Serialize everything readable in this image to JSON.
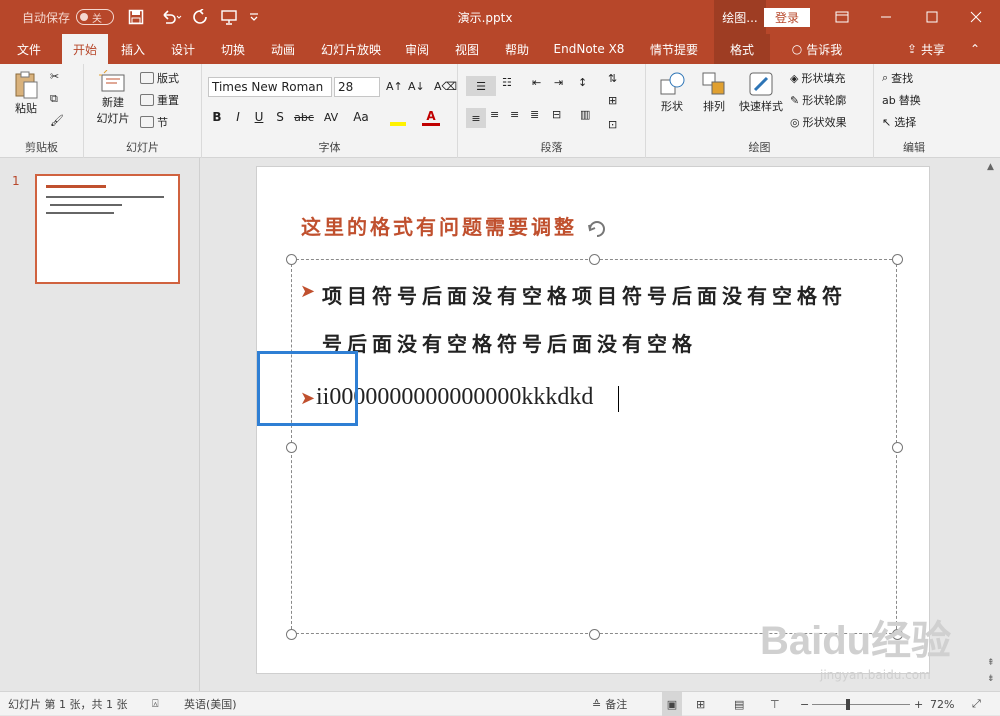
{
  "titlebar": {
    "autosave_label": "自动保存",
    "autosave_state": "关",
    "doc_title": "演示.pptx",
    "context_label": "绘图...",
    "login_label": "登录",
    "icons": [
      "save-icon",
      "undo-icon",
      "redo-icon",
      "present-icon",
      "customize-icon",
      "ribbon-display-icon",
      "minimize-icon",
      "maximize-icon",
      "close-icon"
    ]
  },
  "tabs": [
    "文件",
    "开始",
    "插入",
    "设计",
    "切换",
    "动画",
    "幻灯片放映",
    "审阅",
    "视图",
    "帮助",
    "EndNote X8",
    "情节提要",
    "格式"
  ],
  "active_tab": "开始",
  "tellme": "告诉我",
  "share": "共享",
  "ribbon": {
    "clipboard": {
      "paste": "粘贴",
      "label": "剪贴板"
    },
    "slides": {
      "new_slide": "新建",
      "new_slide2": "幻灯片",
      "layout": "版式",
      "reset": "重置",
      "section": "节",
      "label": "幻灯片"
    },
    "font": {
      "face": "Times New Roman",
      "size": "28",
      "label": "字体",
      "bold": "B",
      "italic": "I",
      "underline": "U",
      "shadow": "S",
      "strike": "abc",
      "spacing": "AV",
      "case": "Aa",
      "font_color": "A"
    },
    "paragraph": {
      "label": "段落"
    },
    "drawing": {
      "shapes": "形状",
      "arrange": "排列",
      "quick_styles": "快速样式",
      "fill": "形状填充",
      "outline": "形状轮廓",
      "effects": "形状效果",
      "label": "绘图"
    },
    "editing": {
      "find": "查找",
      "replace": "替换",
      "select": "选择",
      "label": "编辑"
    }
  },
  "slide_panel": {
    "number": "1"
  },
  "slide": {
    "title": "这里的格式有问题需要调整",
    "para1_line1": "项目符号后面没有空格项目符号后面没有空格符",
    "para1_line2": "号后面没有空格符号后面没有空格",
    "para2": "ii0000000000000000kkkdkd"
  },
  "statusbar": {
    "slide_info": "幻灯片 第 1 张，共 1 张",
    "language": "英语(美国)",
    "notes": "备注",
    "zoom": "72%"
  },
  "watermark": {
    "text": "Baidu经验",
    "url": "jingyan.baidu.com"
  }
}
